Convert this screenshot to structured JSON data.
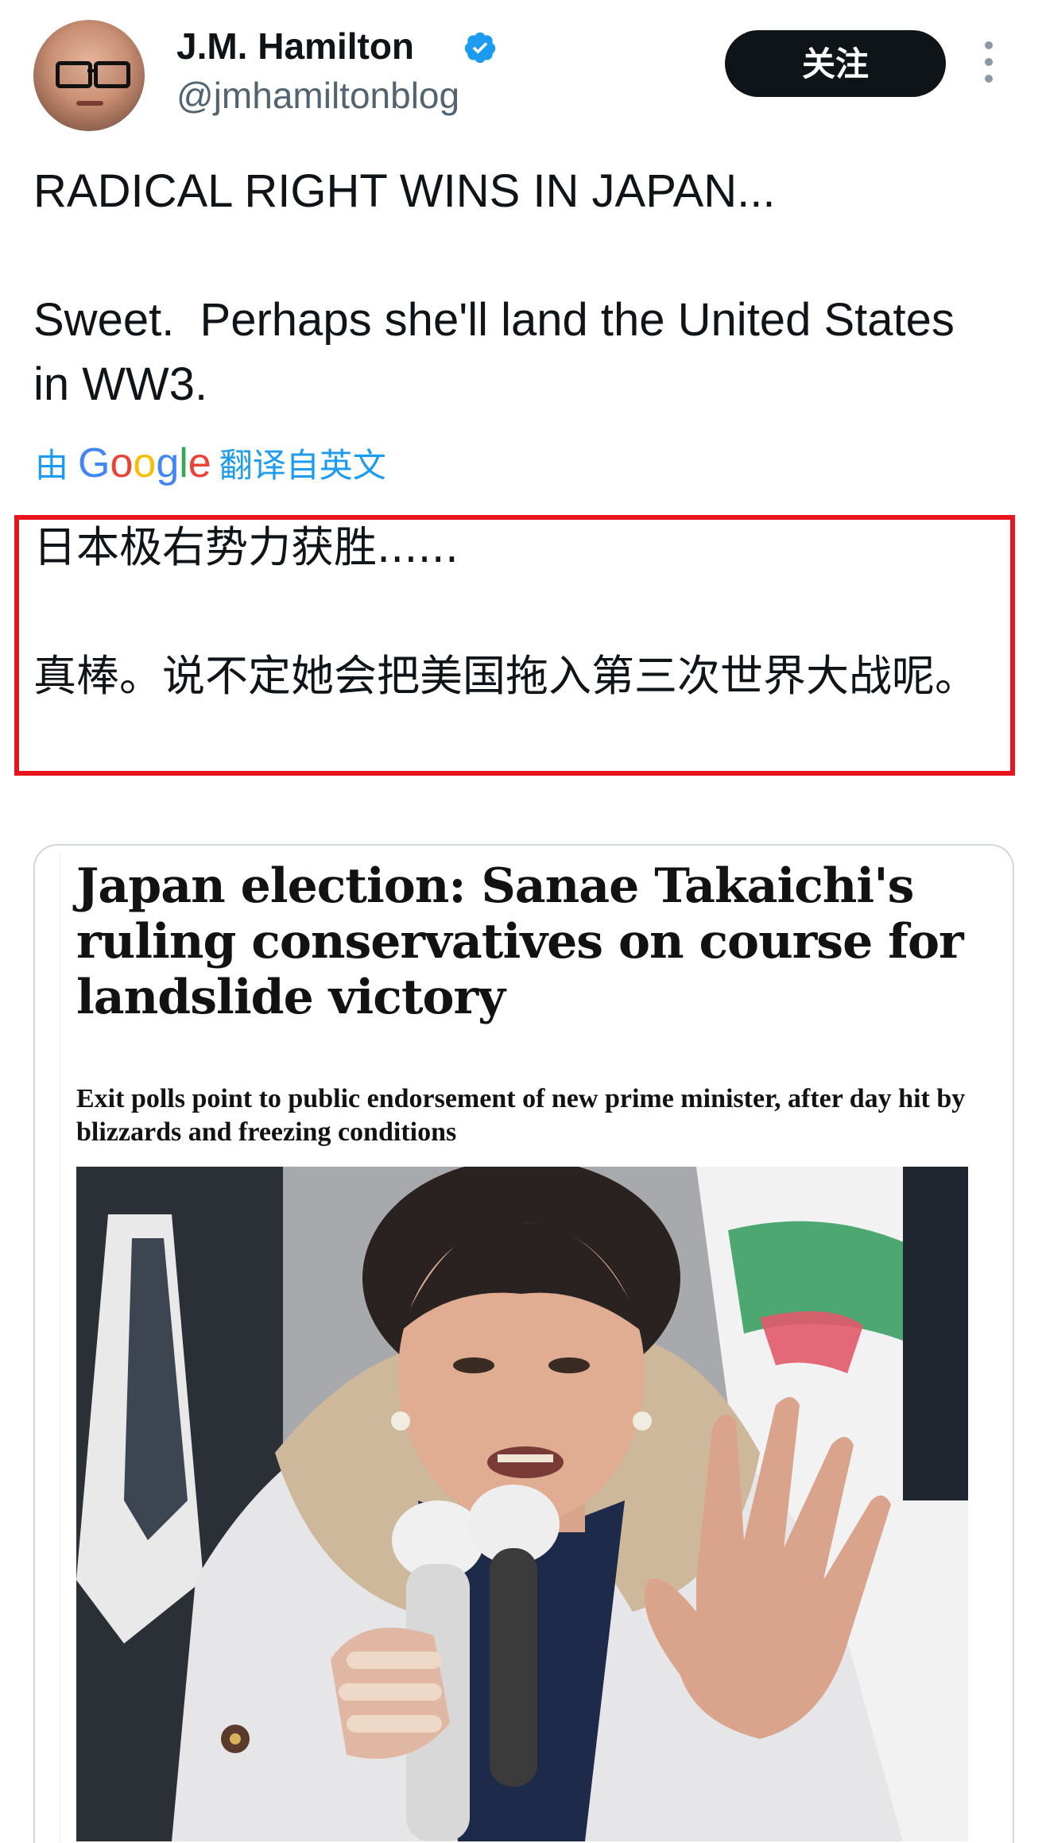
{
  "header": {
    "display_name": "J.M. Hamilton",
    "handle": "@jmhamiltonblog",
    "follow_label": "关注",
    "verified_icon": "verified-badge-icon",
    "more_icon": "more-vertical-icon"
  },
  "tweet": {
    "text_line1": "RADICAL RIGHT WINS IN JAPAN...",
    "text_line2": "Sweet.  Perhaps she'll land the United States in WW3.",
    "translate_prefix": "由",
    "translate_brand": "Google",
    "translate_suffix": "翻译自英文",
    "translated_line1": "日本极右势力获胜......",
    "translated_line2": "真棒。说不定她会把美国拖入第三次世界大战呢。"
  },
  "card": {
    "headline": "Japan election: Sanae Takaichi's ruling conservatives on course for landslide victory",
    "standfirst": "Exit polls point to public endorsement of new prime minister, after day hit by blizzards and freezing conditions"
  },
  "colors": {
    "accent": "#1d9bf0",
    "highlight_border": "#e8141e",
    "follow_bg": "#0f1419",
    "google_blue": "#4285F4",
    "google_red": "#EA4335",
    "google_yellow": "#FBBC05",
    "google_green": "#34A853"
  }
}
